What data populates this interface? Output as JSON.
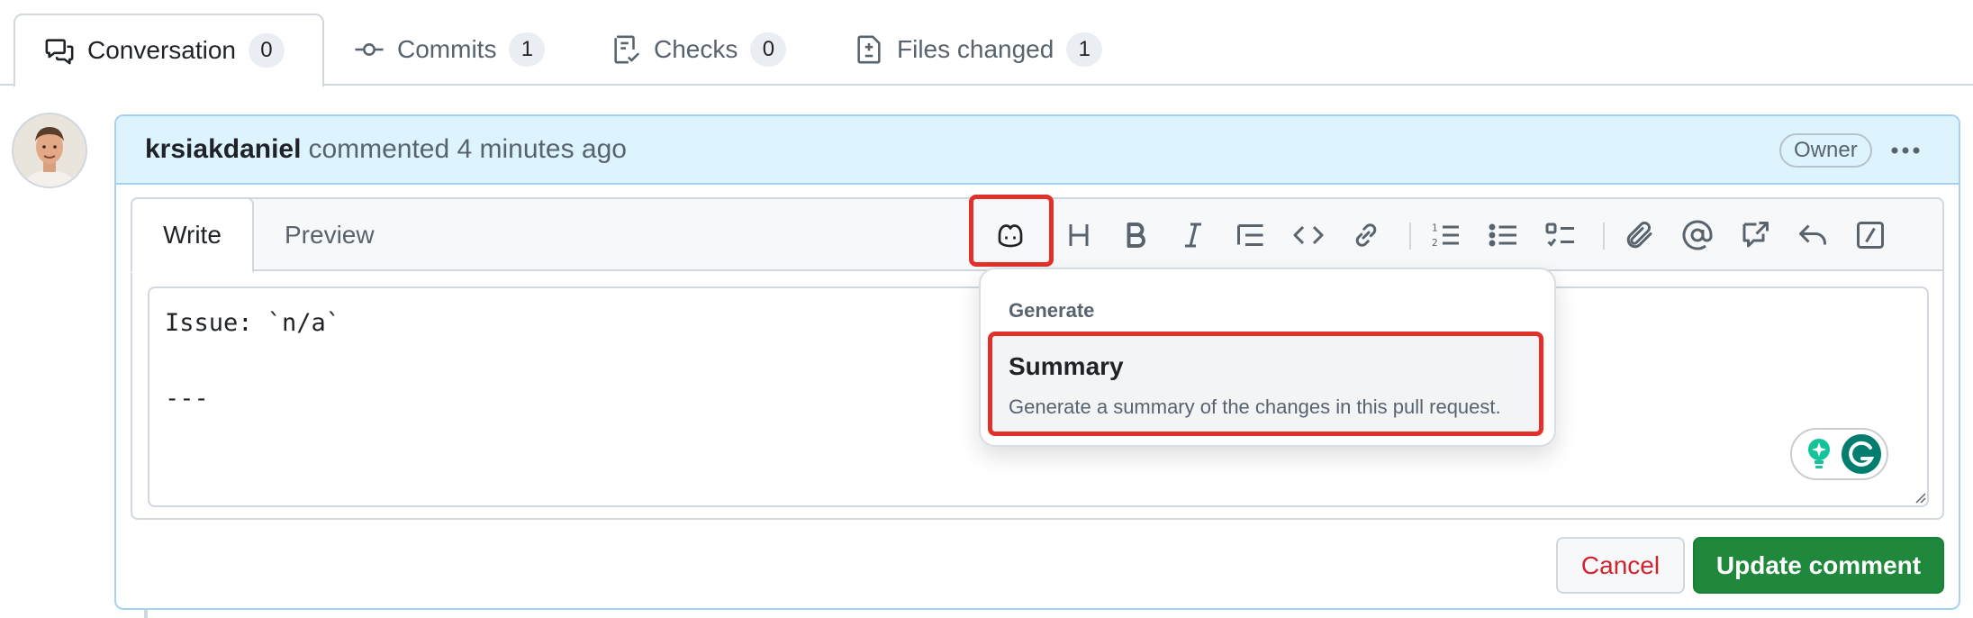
{
  "tabs": [
    {
      "label": "Conversation",
      "count": "0",
      "icon": "comment-discussion-icon"
    },
    {
      "label": "Commits",
      "count": "1",
      "icon": "git-commit-icon"
    },
    {
      "label": "Checks",
      "count": "0",
      "icon": "checklist-icon"
    },
    {
      "label": "Files changed",
      "count": "1",
      "icon": "file-diff-icon"
    }
  ],
  "comment": {
    "author": "krsiakdaniel",
    "meta": "commented 4 minutes ago",
    "badge": "Owner"
  },
  "editor": {
    "tabs": {
      "write": "Write",
      "preview": "Preview"
    },
    "content": "Issue: `n/a`\n\n---",
    "toolbar_icons": [
      "copilot-icon",
      "heading-icon",
      "bold-icon",
      "italic-icon",
      "quote-icon",
      "code-icon",
      "link-icon",
      "ordered-list-icon",
      "unordered-list-icon",
      "task-list-icon",
      "attach-icon",
      "mention-icon",
      "reference-icon",
      "reply-icon",
      "slash-command-icon"
    ]
  },
  "dropdown": {
    "heading": "Generate",
    "item_title": "Summary",
    "item_description": "Generate a summary of the changes in this pull request."
  },
  "buttons": {
    "cancel": "Cancel",
    "update": "Update comment"
  },
  "colors": {
    "accent_blue_bg": "#ddf4ff",
    "highlight_red": "#e2302a",
    "primary_green": "#1f883d",
    "danger_red": "#d1242f"
  }
}
